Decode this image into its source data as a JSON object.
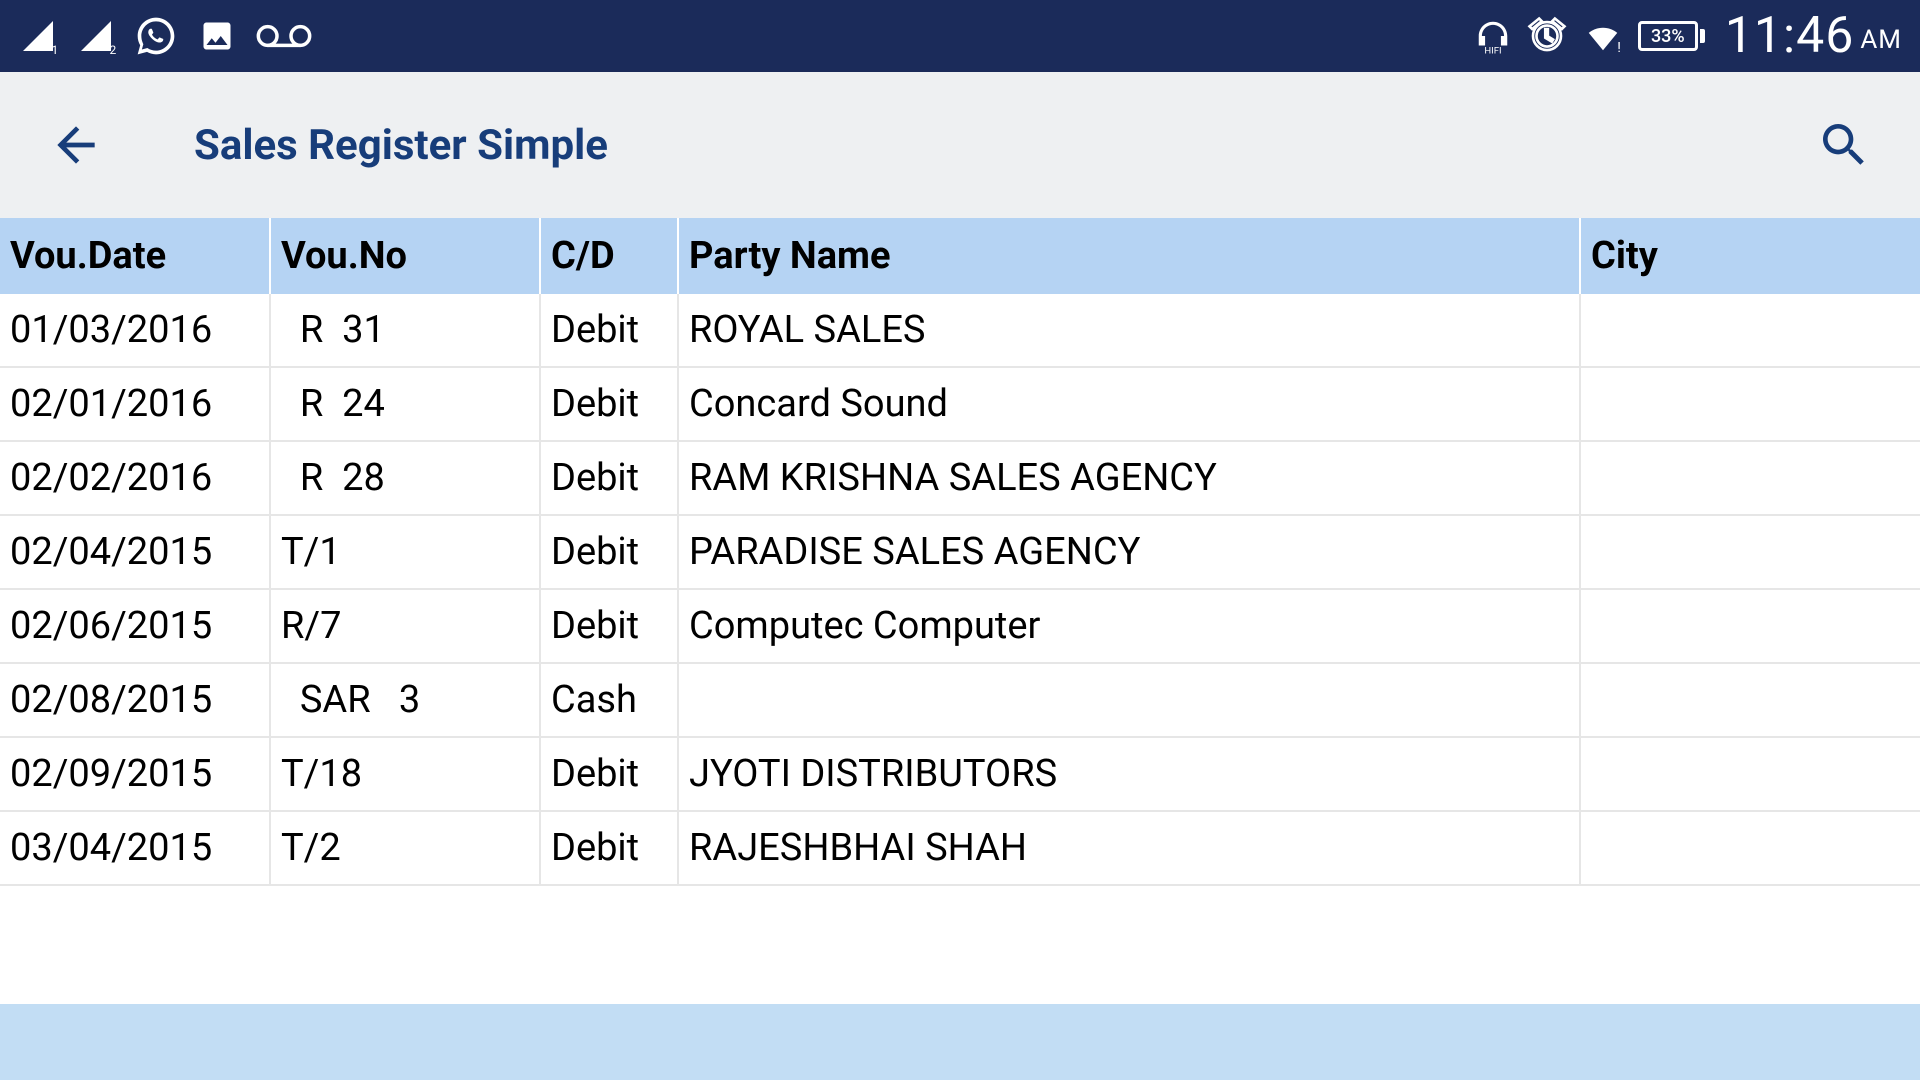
{
  "status": {
    "battery": "33%",
    "time": "11:46",
    "ampm": "AM"
  },
  "header": {
    "title": "Sales Register Simple"
  },
  "table": {
    "headers": {
      "date": "Vou.Date",
      "vouno": "Vou.No",
      "cd": "C/D",
      "party": "Party Name",
      "city": "City"
    },
    "rows": [
      {
        "date": "01/03/2016",
        "vouno": "  R  31",
        "cd": "Debit",
        "party": "ROYAL SALES",
        "city": ""
      },
      {
        "date": "02/01/2016",
        "vouno": "  R  24",
        "cd": "Debit",
        "party": "Concard Sound",
        "city": ""
      },
      {
        "date": "02/02/2016",
        "vouno": "  R  28",
        "cd": "Debit",
        "party": "RAM KRISHNA SALES AGENCY",
        "city": ""
      },
      {
        "date": "02/04/2015",
        "vouno": "T/1",
        "cd": "Debit",
        "party": "PARADISE SALES AGENCY",
        "city": ""
      },
      {
        "date": "02/06/2015",
        "vouno": "R/7",
        "cd": "Debit",
        "party": "Computec Computer",
        "city": ""
      },
      {
        "date": "02/08/2015",
        "vouno": "  SAR   3",
        "cd": "Cash",
        "party": "",
        "city": ""
      },
      {
        "date": "02/09/2015",
        "vouno": "T/18",
        "cd": "Debit",
        "party": "JYOTI DISTRIBUTORS",
        "city": ""
      },
      {
        "date": "03/04/2015",
        "vouno": "T/2",
        "cd": "Debit",
        "party": "RAJESHBHAI SHAH",
        "city": ""
      }
    ]
  }
}
